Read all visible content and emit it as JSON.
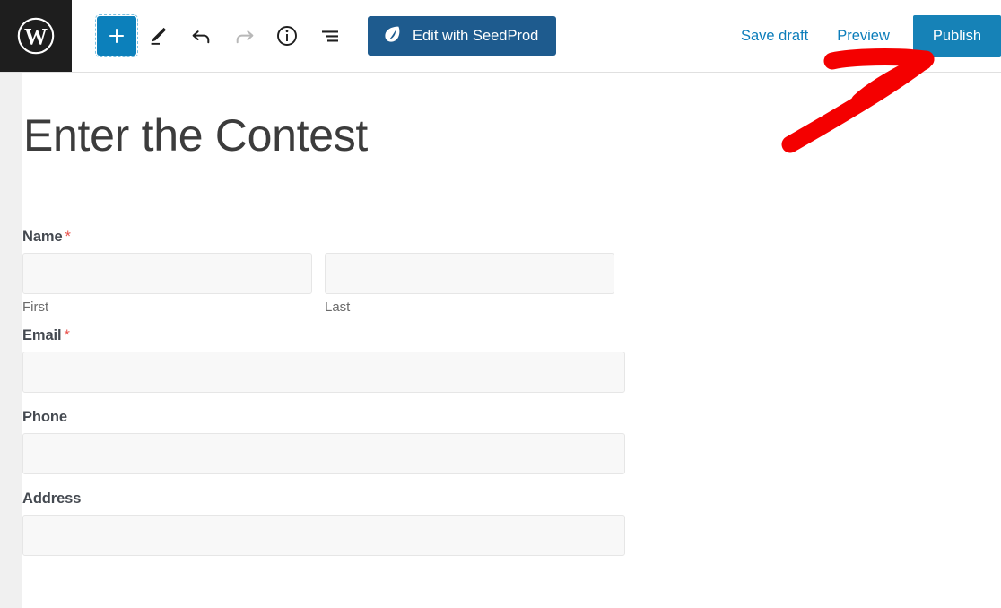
{
  "editor": {
    "logo_icon": "wordpress-logo-icon",
    "toolbar": {
      "add_block_label": "+",
      "add_block_icon": "plus-icon",
      "edit_mode_icon": "pencil-icon",
      "undo_icon": "undo-arrow-icon",
      "redo_icon": "redo-arrow-icon",
      "details_icon": "info-circle-icon",
      "list_view_icon": "list-view-icon",
      "seedprod_button_label": "Edit with SeedProd",
      "seedprod_icon": "seedprod-leaf-icon"
    },
    "actions": {
      "save_draft_label": "Save draft",
      "preview_label": "Preview",
      "publish_label": "Publish"
    },
    "colors": {
      "add_block_blue": "#0c80bb",
      "seedprod_blue": "#1e5b8e",
      "publish_blue": "#1682b7",
      "link_blue": "#0c7dba",
      "logo_dark": "#1e1e1e",
      "required_red": "#e8504a",
      "annotation_red": "#f40000"
    }
  },
  "post": {
    "title": "Enter the Contest"
  },
  "form": {
    "fields": [
      {
        "label": "Name",
        "required": true,
        "required_mark": "*",
        "type": "name-split",
        "subfields": [
          {
            "sublabel": "First",
            "value": ""
          },
          {
            "sublabel": "Last",
            "value": ""
          }
        ]
      },
      {
        "label": "Email",
        "required": true,
        "required_mark": "*",
        "type": "text",
        "value": ""
      },
      {
        "label": "Phone",
        "required": false,
        "type": "text",
        "value": ""
      },
      {
        "label": "Address",
        "required": false,
        "type": "text",
        "value": ""
      }
    ]
  },
  "annotation": {
    "type": "arrow",
    "points_to": "publish-button",
    "color": "#f40000"
  }
}
